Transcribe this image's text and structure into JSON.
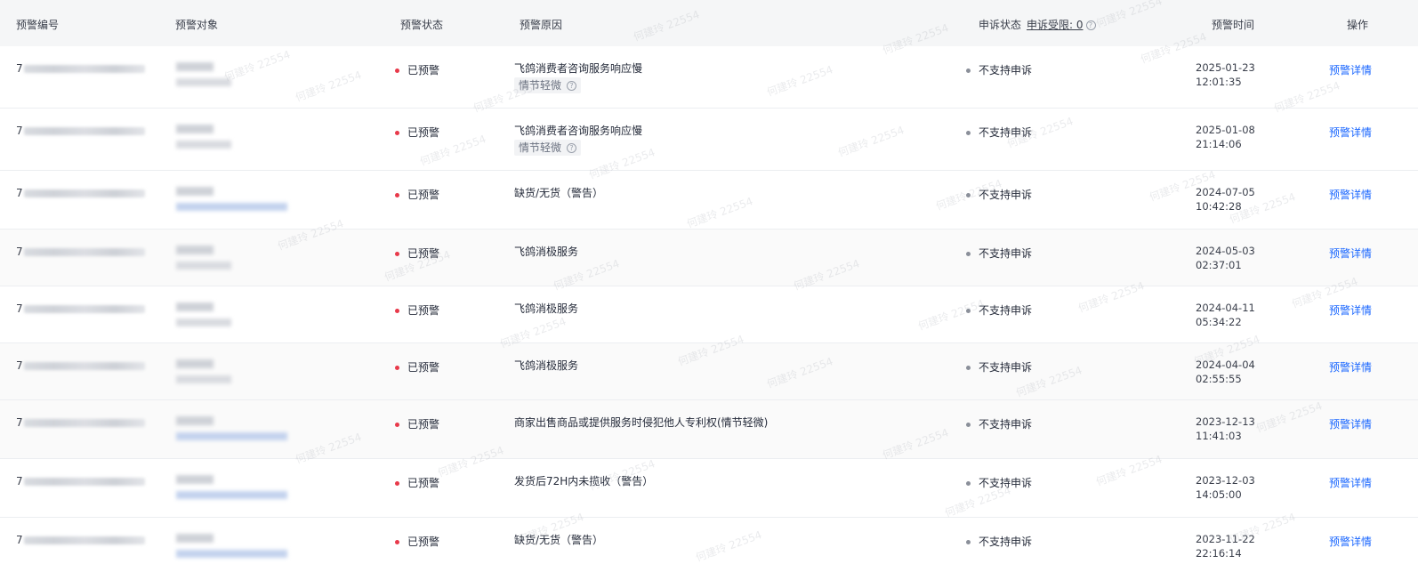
{
  "header": {
    "col_id": "预警编号",
    "col_object": "预警对象",
    "col_status": "预警状态",
    "col_reason": "预警原因",
    "col_appeal": "申诉状态",
    "appeal_limit": "申诉受限: 0",
    "col_time": "预警时间",
    "col_action": "操作"
  },
  "watermark": "何建玲 22554",
  "rows": [
    {
      "id_prefix": "7",
      "status": "已预警",
      "reason": "飞鸽消费者咨询服务响应慢",
      "tag": "情节轻微",
      "appeal": "不支持申诉",
      "date": "2025-01-23",
      "clock": "12:01:35",
      "action": "预警详情",
      "obj_link": false
    },
    {
      "id_prefix": "7",
      "status": "已预警",
      "reason": "飞鸽消费者咨询服务响应慢",
      "tag": "情节轻微",
      "appeal": "不支持申诉",
      "date": "2025-01-08",
      "clock": "21:14:06",
      "action": "预警详情",
      "obj_link": false
    },
    {
      "id_prefix": "7",
      "status": "已预警",
      "reason": "缺货/无货（警告）",
      "tag": "",
      "appeal": "不支持申诉",
      "date": "2024-07-05",
      "clock": "10:42:28",
      "action": "预警详情",
      "obj_link": true
    },
    {
      "id_prefix": "7",
      "status": "已预警",
      "reason": "飞鸽消极服务",
      "tag": "",
      "appeal": "不支持申诉",
      "date": "2024-05-03",
      "clock": "02:37:01",
      "action": "预警详情",
      "obj_link": false
    },
    {
      "id_prefix": "7",
      "status": "已预警",
      "reason": "飞鸽消极服务",
      "tag": "",
      "appeal": "不支持申诉",
      "date": "2024-04-11",
      "clock": "05:34:22",
      "action": "预警详情",
      "obj_link": false
    },
    {
      "id_prefix": "7",
      "status": "已预警",
      "reason": "飞鸽消极服务",
      "tag": "",
      "appeal": "不支持申诉",
      "date": "2024-04-04",
      "clock": "02:55:55",
      "action": "预警详情",
      "obj_link": false
    },
    {
      "id_prefix": "7",
      "status": "已预警",
      "reason": "商家出售商品或提供服务时侵犯他人专利权(情节轻微)",
      "tag": "",
      "appeal": "不支持申诉",
      "date": "2023-12-13",
      "clock": "11:41:03",
      "action": "预警详情",
      "obj_link": true
    },
    {
      "id_prefix": "7",
      "status": "已预警",
      "reason": "发货后72H内未揽收（警告）",
      "tag": "",
      "appeal": "不支持申诉",
      "date": "2023-12-03",
      "clock": "14:05:00",
      "action": "预警详情",
      "obj_link": true
    },
    {
      "id_prefix": "7",
      "status": "已预警",
      "reason": "缺货/无货（警告）",
      "tag": "",
      "appeal": "不支持申诉",
      "date": "2023-11-22",
      "clock": "22:16:14",
      "action": "预警详情",
      "obj_link": true
    }
  ]
}
